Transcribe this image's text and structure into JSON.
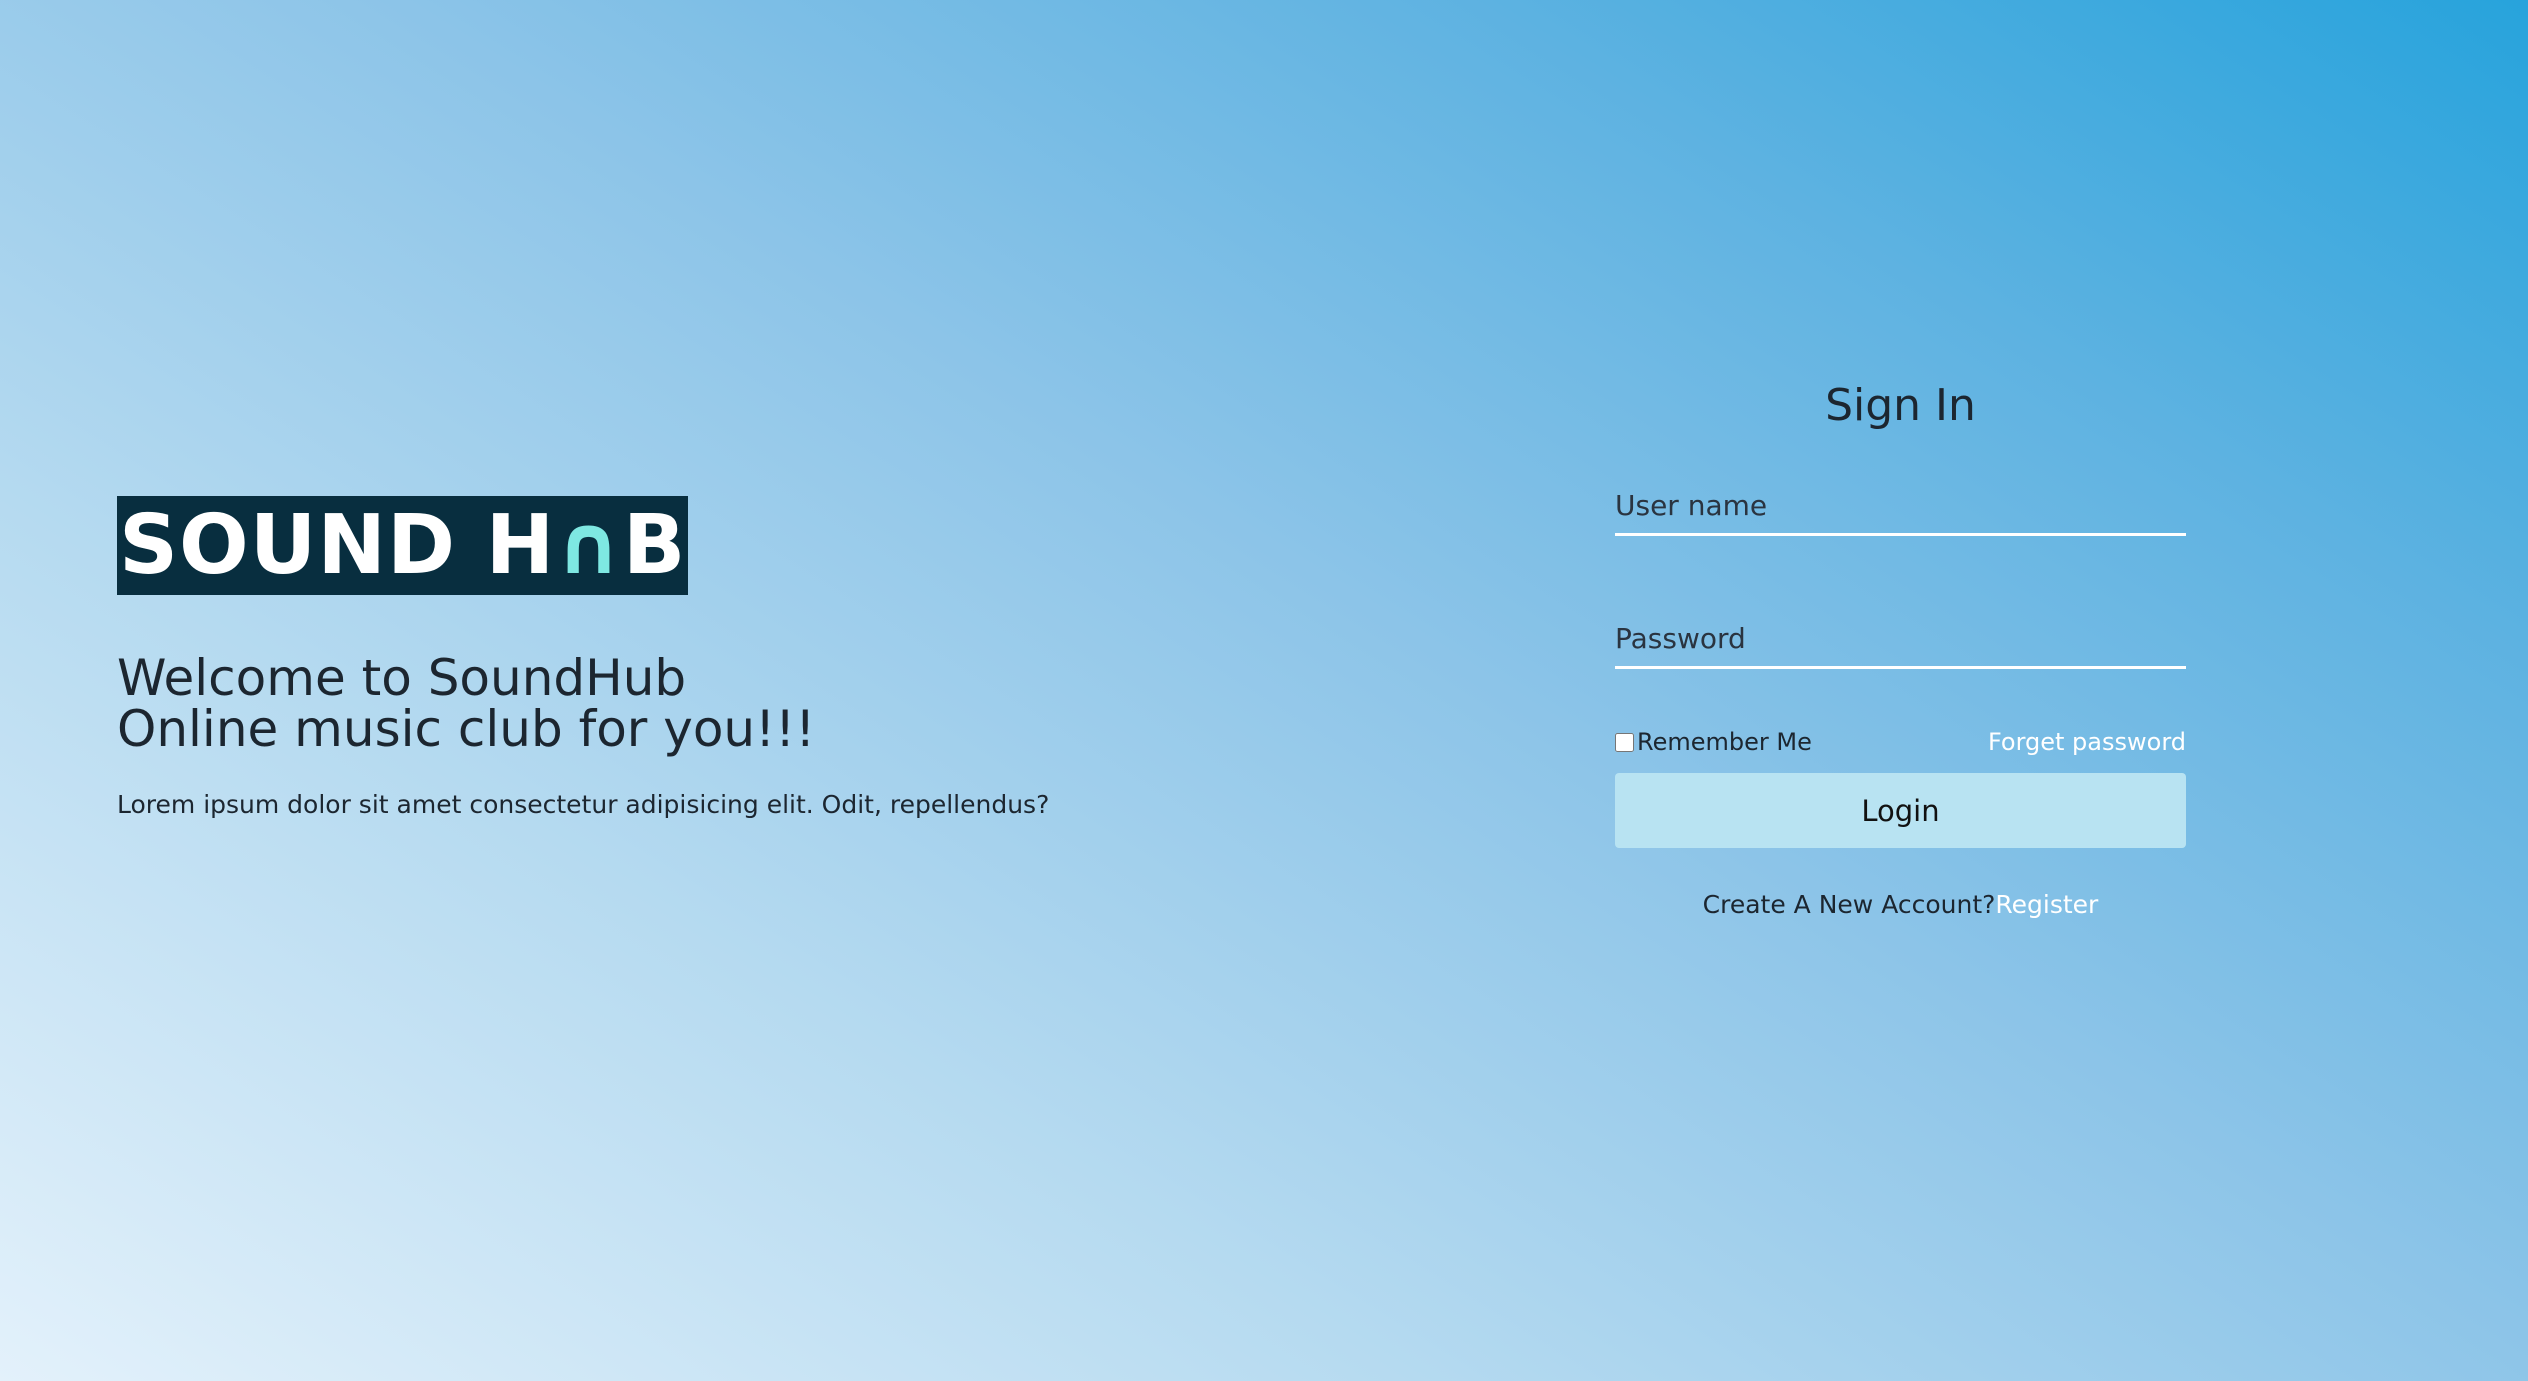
{
  "brand": {
    "logo_prefix": "SOUND H",
    "logo_accent": "∩",
    "logo_suffix": "B",
    "logo_bg": "#082e3f",
    "logo_accent_color": "#7ee8e2"
  },
  "hero": {
    "welcome_line1": "Welcome to SoundHub",
    "welcome_line2": "Online music club for you!!!",
    "description": "Lorem ipsum dolor sit amet consectetur adipisicing elit. Odit, repellendus?"
  },
  "signin": {
    "title": "Sign In",
    "username_placeholder": "User name",
    "username_value": "",
    "password_placeholder": "Password",
    "password_value": "",
    "remember_label": "Remember Me",
    "remember_checked": false,
    "forget_label": "Forget password",
    "login_label": "Login",
    "create_prompt": "Create A New Account?",
    "register_label": "Register"
  },
  "colors": {
    "gradient_light": "#e3f1fb",
    "gradient_dark": "#27a3dc",
    "button_bg": "#b8e3f2",
    "link": "#ffffff"
  }
}
